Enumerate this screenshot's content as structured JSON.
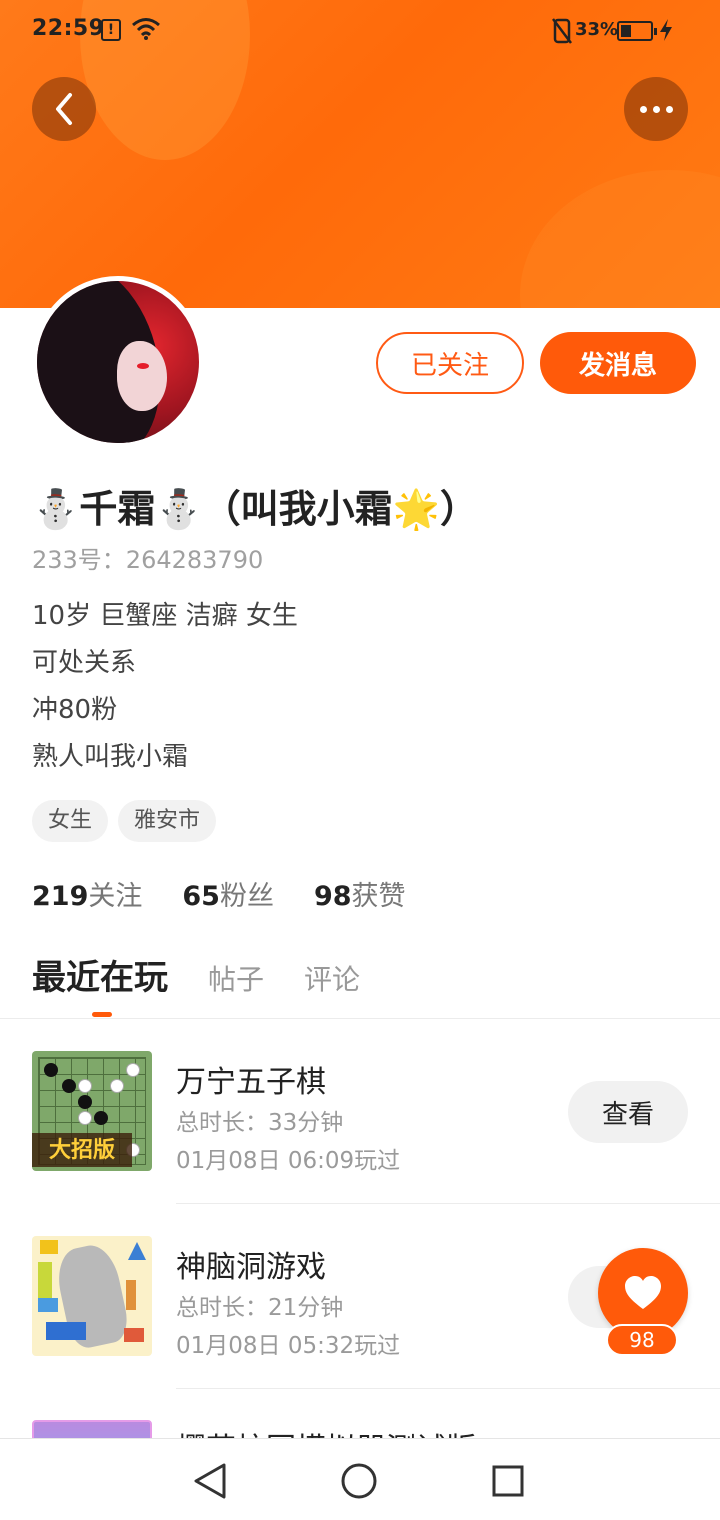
{
  "status_bar": {
    "time": "22:59",
    "alert_glyph": "!",
    "battery_percent": "33%"
  },
  "header": {
    "gradient_colors": [
      "#ff7a1a",
      "#ff6a0a"
    ],
    "back_icon": "chevron-left-icon",
    "more_icon": "more-horizontal-icon"
  },
  "profile": {
    "follow_label": "已关注",
    "message_label": "发消息",
    "nickname": "⛄千霜⛄（叫我小霜🌟）",
    "user_id": "233号：264283790",
    "bio": [
      "10岁 巨蟹座 洁癖 女生",
      "可处关系",
      "冲80粉",
      "熟人叫我小霜"
    ],
    "tags": [
      "女生",
      "雅安市"
    ],
    "stats": [
      {
        "num": "219",
        "label": "关注"
      },
      {
        "num": "65",
        "label": "粉丝"
      },
      {
        "num": "98",
        "label": "获赞"
      }
    ]
  },
  "tabs": [
    {
      "label": "最近在玩",
      "active": true
    },
    {
      "label": "帖子",
      "active": false
    },
    {
      "label": "评论",
      "active": false
    }
  ],
  "games": [
    {
      "title": "万宁五子棋",
      "duration": "总时长：33分钟",
      "played": "01月08日 06:09玩过",
      "button": "查看",
      "thumb_text": "大招版"
    },
    {
      "title": "神脑洞游戏",
      "duration": "总时长：21分钟",
      "played": "01月08日 05:32玩过",
      "button": "查看"
    },
    {
      "title": "樱花校园模拟器测试版"
    }
  ],
  "like_fab": {
    "count": "98",
    "icon": "heart-icon"
  },
  "nav": {
    "back_icon": "triangle-back-icon",
    "home_icon": "circle-home-icon",
    "recents_icon": "square-recents-icon"
  },
  "accent_color": "#ff5a0a"
}
